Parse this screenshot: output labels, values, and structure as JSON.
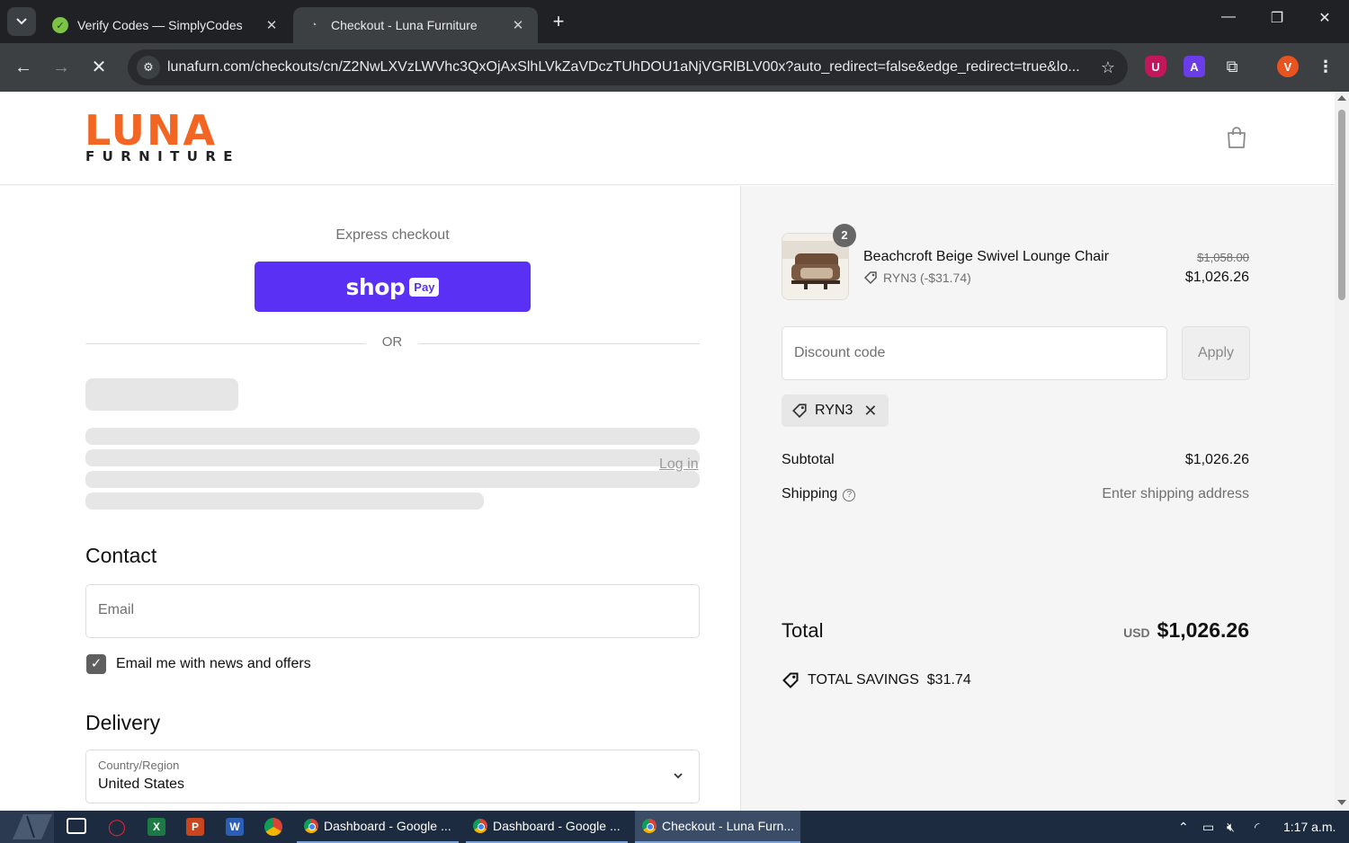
{
  "browser": {
    "tabs": [
      {
        "title": "Verify Codes — SimplyCodes",
        "active": false
      },
      {
        "title": "Checkout - Luna Furniture",
        "active": true
      }
    ],
    "url": "lunafurn.com/checkouts/cn/Z2NwLXVzLWVhc3QxOjAxSlhLVkZaVDczTUhDOU1aNjVGRlBLV00x?auto_redirect=false&edge_redirect=true&lo...",
    "profile_initial": "V",
    "ext_a_letter": "A",
    "ext_u_letter": "U"
  },
  "header": {
    "logo_main": "LUNA",
    "logo_sub": "FURNITURE"
  },
  "checkout": {
    "express_label": "Express checkout",
    "shop_label": "shop",
    "pay_label": "Pay",
    "or_label": "OR",
    "contact_title": "Contact",
    "login_label": "Log in",
    "email_placeholder": "Email",
    "news_label": "Email me with news and offers",
    "delivery_title": "Delivery",
    "country_label": "Country/Region",
    "country_value": "United States"
  },
  "summary": {
    "quantity": "2",
    "product_name": "Beachcroft Beige Swivel Lounge Chair",
    "product_discount": "RYN3 (-$31.74)",
    "original_price": "$1,058.00",
    "price": "$1,026.26",
    "discount_placeholder": "Discount code",
    "apply_label": "Apply",
    "applied_code": "RYN3",
    "subtotal_label": "Subtotal",
    "subtotal_value": "$1,026.26",
    "shipping_label": "Shipping",
    "shipping_value": "Enter shipping address",
    "total_label": "Total",
    "currency": "USD",
    "total_value": "$1,026.26",
    "savings_label": "TOTAL SAVINGS",
    "savings_value": "$31.74"
  },
  "taskbar": {
    "apps": [
      {
        "label": "Dashboard - Google ...",
        "active": false
      },
      {
        "label": "Dashboard - Google ...",
        "active": false
      },
      {
        "label": "Checkout - Luna Furn...",
        "active": true
      }
    ],
    "clock": "1:17 a.m."
  },
  "colors": {
    "brand_orange": "#f26522",
    "shop_pay_purple": "#5a31f4"
  }
}
